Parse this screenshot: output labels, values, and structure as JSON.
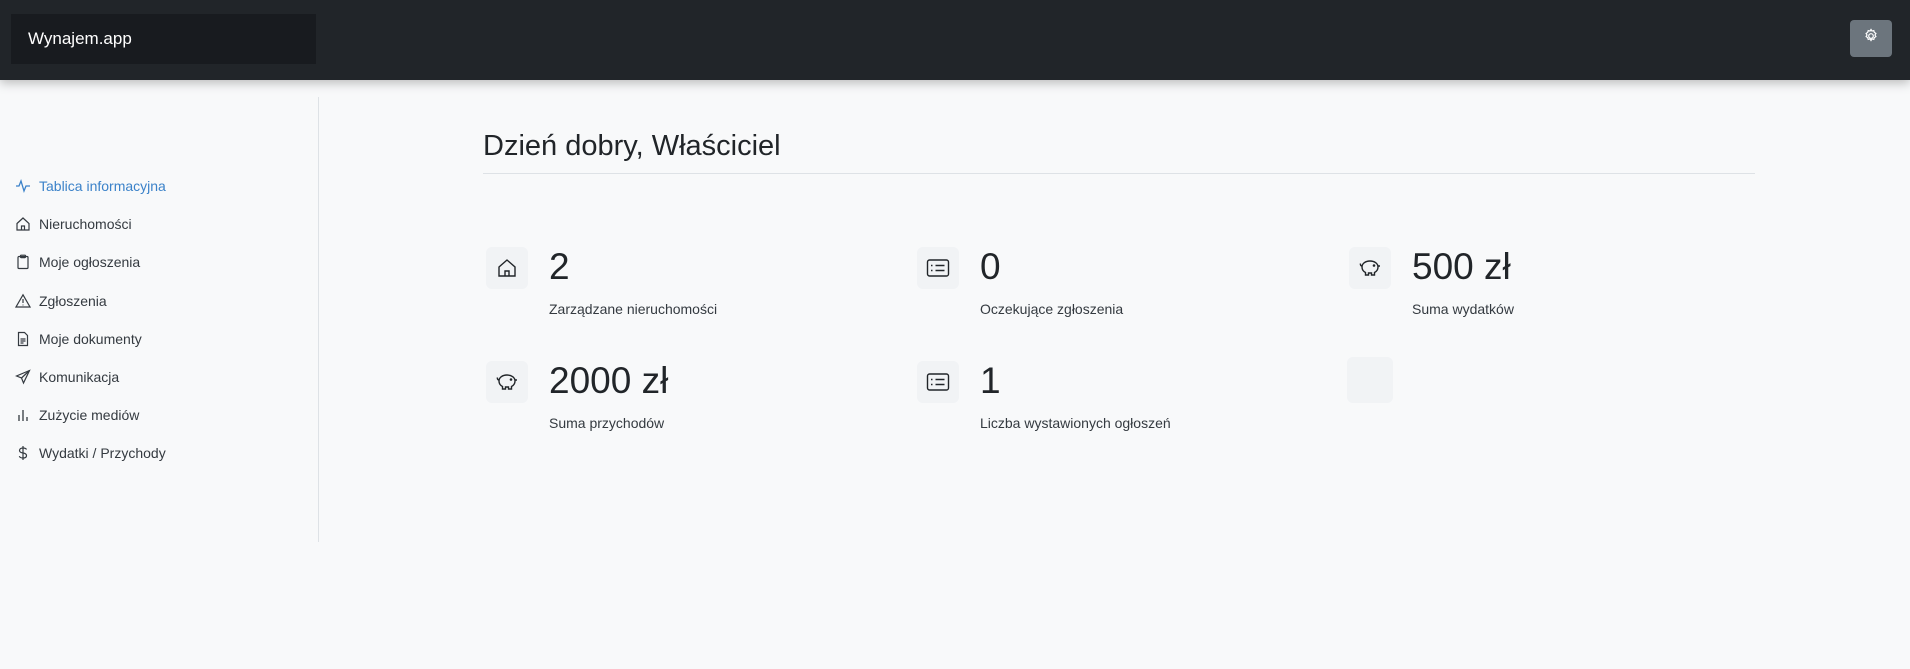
{
  "app": {
    "brand": "Wynajem.app"
  },
  "header": {
    "settings_icon": "gear-icon"
  },
  "sidebar": {
    "items": [
      {
        "label": "Tablica informacyjna",
        "icon": "activity-icon",
        "active": true
      },
      {
        "label": "Nieruchomości",
        "icon": "house-icon"
      },
      {
        "label": "Moje ogłoszenia",
        "icon": "clipboard-icon"
      },
      {
        "label": "Zgłoszenia",
        "icon": "warning-icon"
      },
      {
        "label": "Moje dokumenty",
        "icon": "document-icon"
      },
      {
        "label": "Komunikacja",
        "icon": "send-icon"
      },
      {
        "label": "Zużycie mediów",
        "icon": "bar-chart-icon"
      },
      {
        "label": "Wydatki / Przychody",
        "icon": "dollar-icon"
      }
    ]
  },
  "main": {
    "greeting": "Dzień dobry, Właściciel",
    "stats": [
      {
        "value": "2",
        "label": "Zarządzane nieruchomości",
        "icon": "house-icon"
      },
      {
        "value": "0",
        "label": "Oczekujące zgłoszenia",
        "icon": "list-card-icon"
      },
      {
        "value": "500 zł",
        "label": "Suma wydatków",
        "icon": "piggy-bank-icon"
      },
      {
        "value": "2000 zł",
        "label": "Suma przychodów",
        "icon": "piggy-bank-icon"
      },
      {
        "value": "1",
        "label": "Liczba wystawionych ogłoszeń",
        "icon": "list-card-icon"
      }
    ]
  }
}
